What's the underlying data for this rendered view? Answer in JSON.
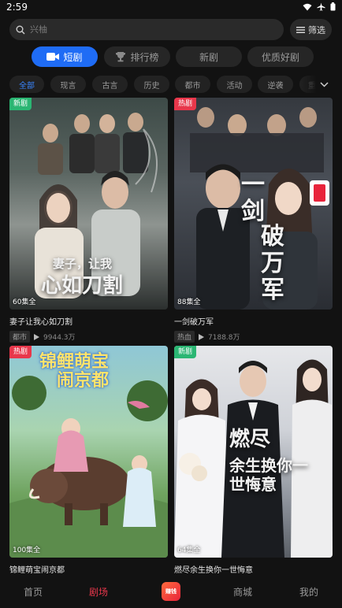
{
  "status_bar": {
    "time": "2:59"
  },
  "search": {
    "placeholder": "兴柚"
  },
  "filter": {
    "label": "筛选"
  },
  "category_tabs": [
    {
      "label": "短剧"
    },
    {
      "label": "排行榜"
    },
    {
      "label": "新剧"
    },
    {
      "label": "优质好剧"
    }
  ],
  "genres": [
    "全部",
    "现言",
    "古言",
    "历史",
    "都市",
    "活动",
    "逆袭",
    "重"
  ],
  "cards": [
    {
      "badge": "新剧",
      "episodes": "60集全",
      "title": "妻子让我心如刀割",
      "genre": "都市",
      "views": "9944.3万",
      "poster_line1": "妻子，让我",
      "poster_line2": "心如刀割"
    },
    {
      "badge": "热剧",
      "episodes": "88集全",
      "title": "一剑破万军",
      "genre": "热血",
      "views": "7188.8万",
      "poster_line1": "一剑",
      "poster_line2": "破万军"
    },
    {
      "badge": "热剧",
      "episodes": "100集全",
      "title": "锦鲤萌宝闹京都",
      "poster_line1": "锦鲤萌宝",
      "poster_line2": "闹京都"
    },
    {
      "badge": "新剧",
      "episodes": "64集全",
      "title": "燃尽余生换你一世悔意",
      "poster_line1": "燃尽",
      "poster_line2": "余生换你一世悔意"
    }
  ],
  "bottom_nav": [
    {
      "label": "首页"
    },
    {
      "label": "剧场"
    },
    {
      "label": "赚钱"
    },
    {
      "label": "商城"
    },
    {
      "label": "我的"
    }
  ]
}
